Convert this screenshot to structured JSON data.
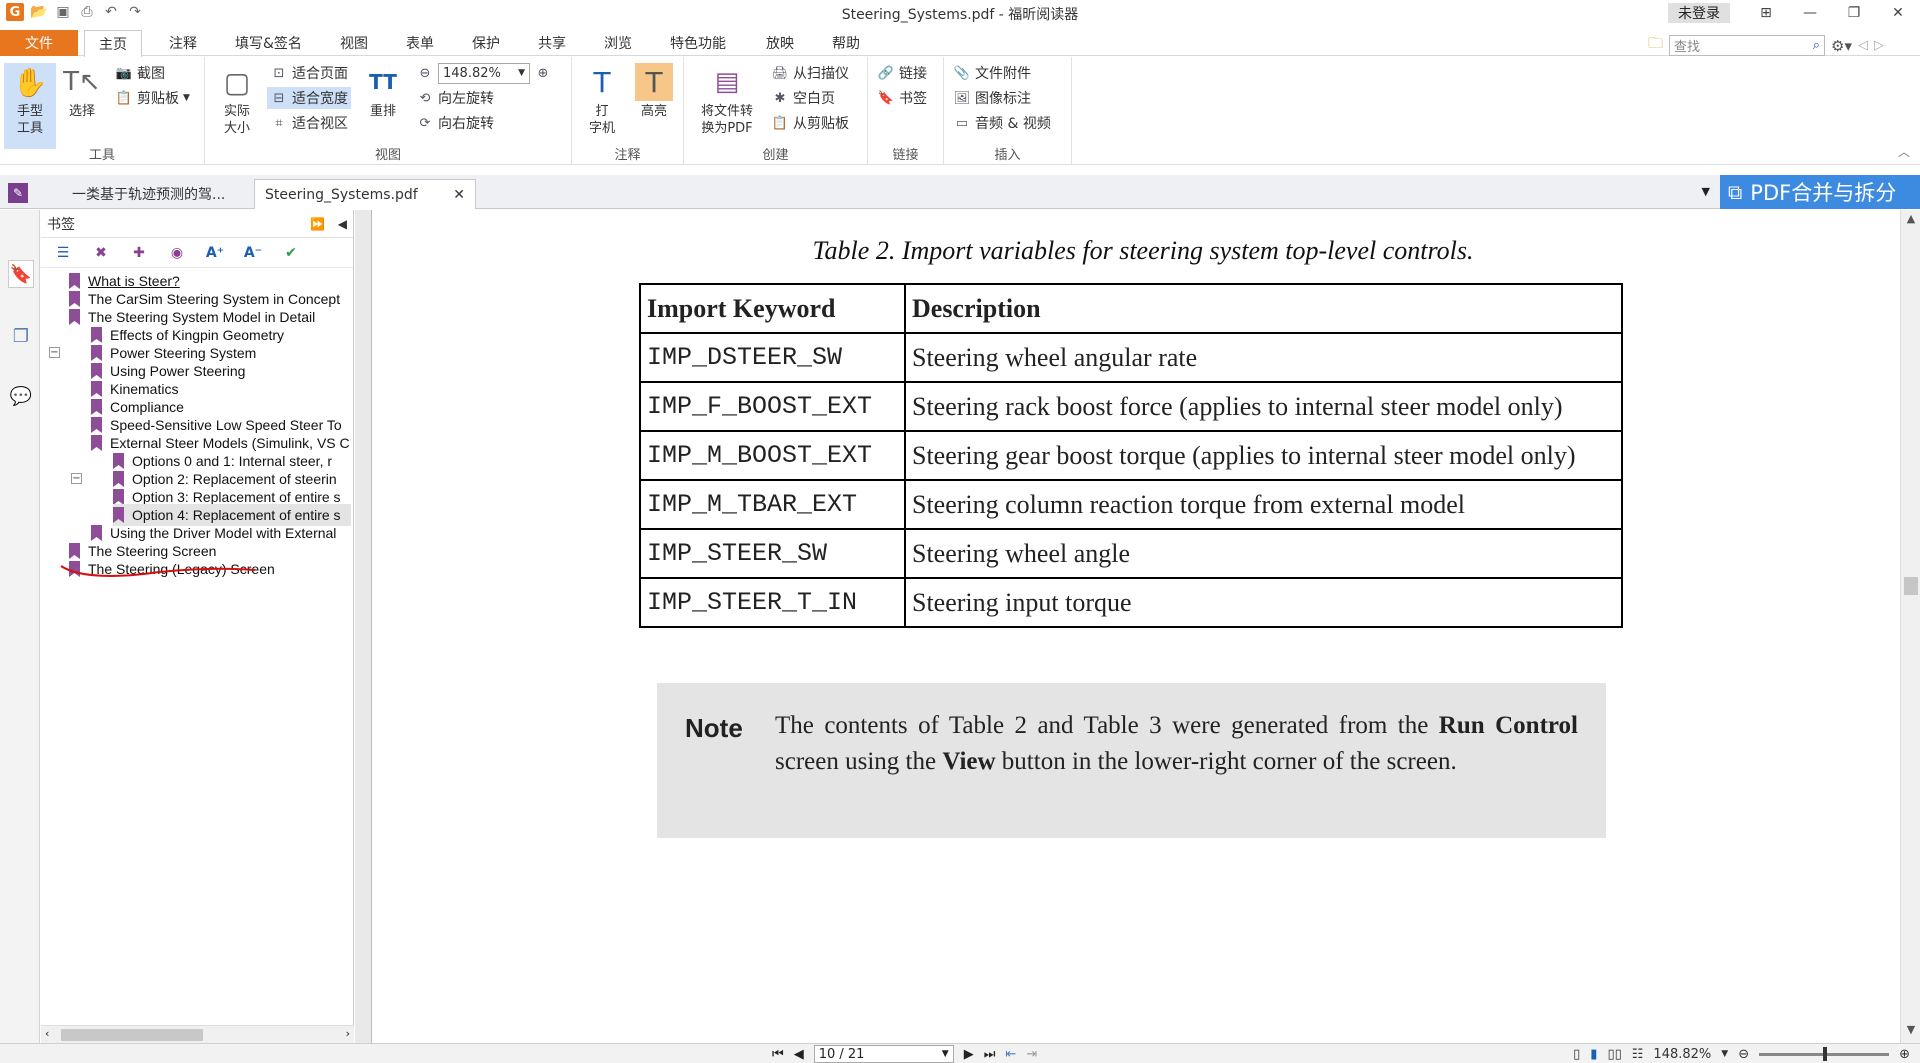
{
  "window": {
    "title": "Steering_Systems.pdf - 福昕阅读器",
    "login_label": "未登录"
  },
  "menu": {
    "items": [
      "文件",
      "主页",
      "注释",
      "填写&签名",
      "视图",
      "表单",
      "保护",
      "共享",
      "浏览",
      "特色功能",
      "放映",
      "帮助"
    ],
    "search_placeholder": "查找"
  },
  "ribbon": {
    "tools": {
      "hand_label": "手型\n工具",
      "select_label": "选择",
      "screenshot_label": "截图",
      "clipboard_label": "剪贴板",
      "group_label": "工具"
    },
    "view": {
      "actual_size_label": "实际\n大小",
      "fit_page_label": "适合页面",
      "fit_width_label": "适合宽度",
      "fit_visible_label": "适合视区",
      "reflow_label": "重排",
      "zoom_value": "148.82%",
      "rotate_left_label": "向左旋转",
      "rotate_right_label": "向右旋转",
      "group_label": "视图"
    },
    "comment": {
      "typewriter_label": "打\n字机",
      "highlight_label": "高亮",
      "group_label": "注释"
    },
    "create": {
      "convert_label": "将文件转\n换为PDF",
      "from_scanner_label": "从扫描仪",
      "blank_label": "空白页",
      "from_clipboard_label": "从剪贴板",
      "group_label": "创建"
    },
    "links": {
      "link_label": "链接",
      "bookmark_label": "书签",
      "group_label": "链接"
    },
    "insert": {
      "attachment_label": "文件附件",
      "image_label": "图像标注",
      "media_label": "音频 & 视频",
      "group_label": "插入"
    }
  },
  "tabs": {
    "items": [
      "一类基于轨迹预测的驾...",
      "Steering_Systems.pdf"
    ],
    "merge_label": "PDF合并与拆分"
  },
  "bookmarks": {
    "title": "书签",
    "items": [
      "What is Steer?",
      "The CarSim Steering System in Concept",
      "The Steering System Model in Detail",
      "Effects of Kingpin Geometry",
      "Power Steering System",
      "Using Power Steering",
      "Kinematics",
      "Compliance",
      "Speed-Sensitive Low Speed Steer To",
      "External Steer Models (Simulink, VS C",
      "Options 0 and 1: Internal steer, r",
      "Option 2: Replacement of steerin",
      "Option 3: Replacement of entire s",
      "Option 4: Replacement of entire s",
      "Using the Driver Model with External",
      "The Steering Screen",
      "The Steering (Legacy) Screen"
    ]
  },
  "document": {
    "caption": "Table 2. Import variables for steering system top-level controls.",
    "table": {
      "headers": [
        "Import Keyword",
        "Description"
      ],
      "rows": [
        [
          "IMP_DSTEER_SW",
          "Steering wheel angular rate"
        ],
        [
          "IMP_F_BOOST_EXT",
          "Steering rack boost force (applies to internal steer model only)"
        ],
        [
          "IMP_M_BOOST_EXT",
          "Steering gear boost torque (applies to internal steer model only)"
        ],
        [
          "IMP_M_TBAR_EXT",
          "Steering column reaction torque from external model"
        ],
        [
          "IMP_STEER_SW",
          "Steering wheel angle"
        ],
        [
          "IMP_STEER_T_IN",
          "Steering input torque"
        ]
      ]
    },
    "note": {
      "label": "Note",
      "text_1": "The contents of Table 2 and Table 3 were generated from the ",
      "bold_1": "Run Control",
      "text_2": " screen using the ",
      "bold_2": "View",
      "text_3": " button in the lower-right corner of the screen."
    }
  },
  "status": {
    "page_indicator": "10 / 21",
    "zoom": "148.82%"
  }
}
